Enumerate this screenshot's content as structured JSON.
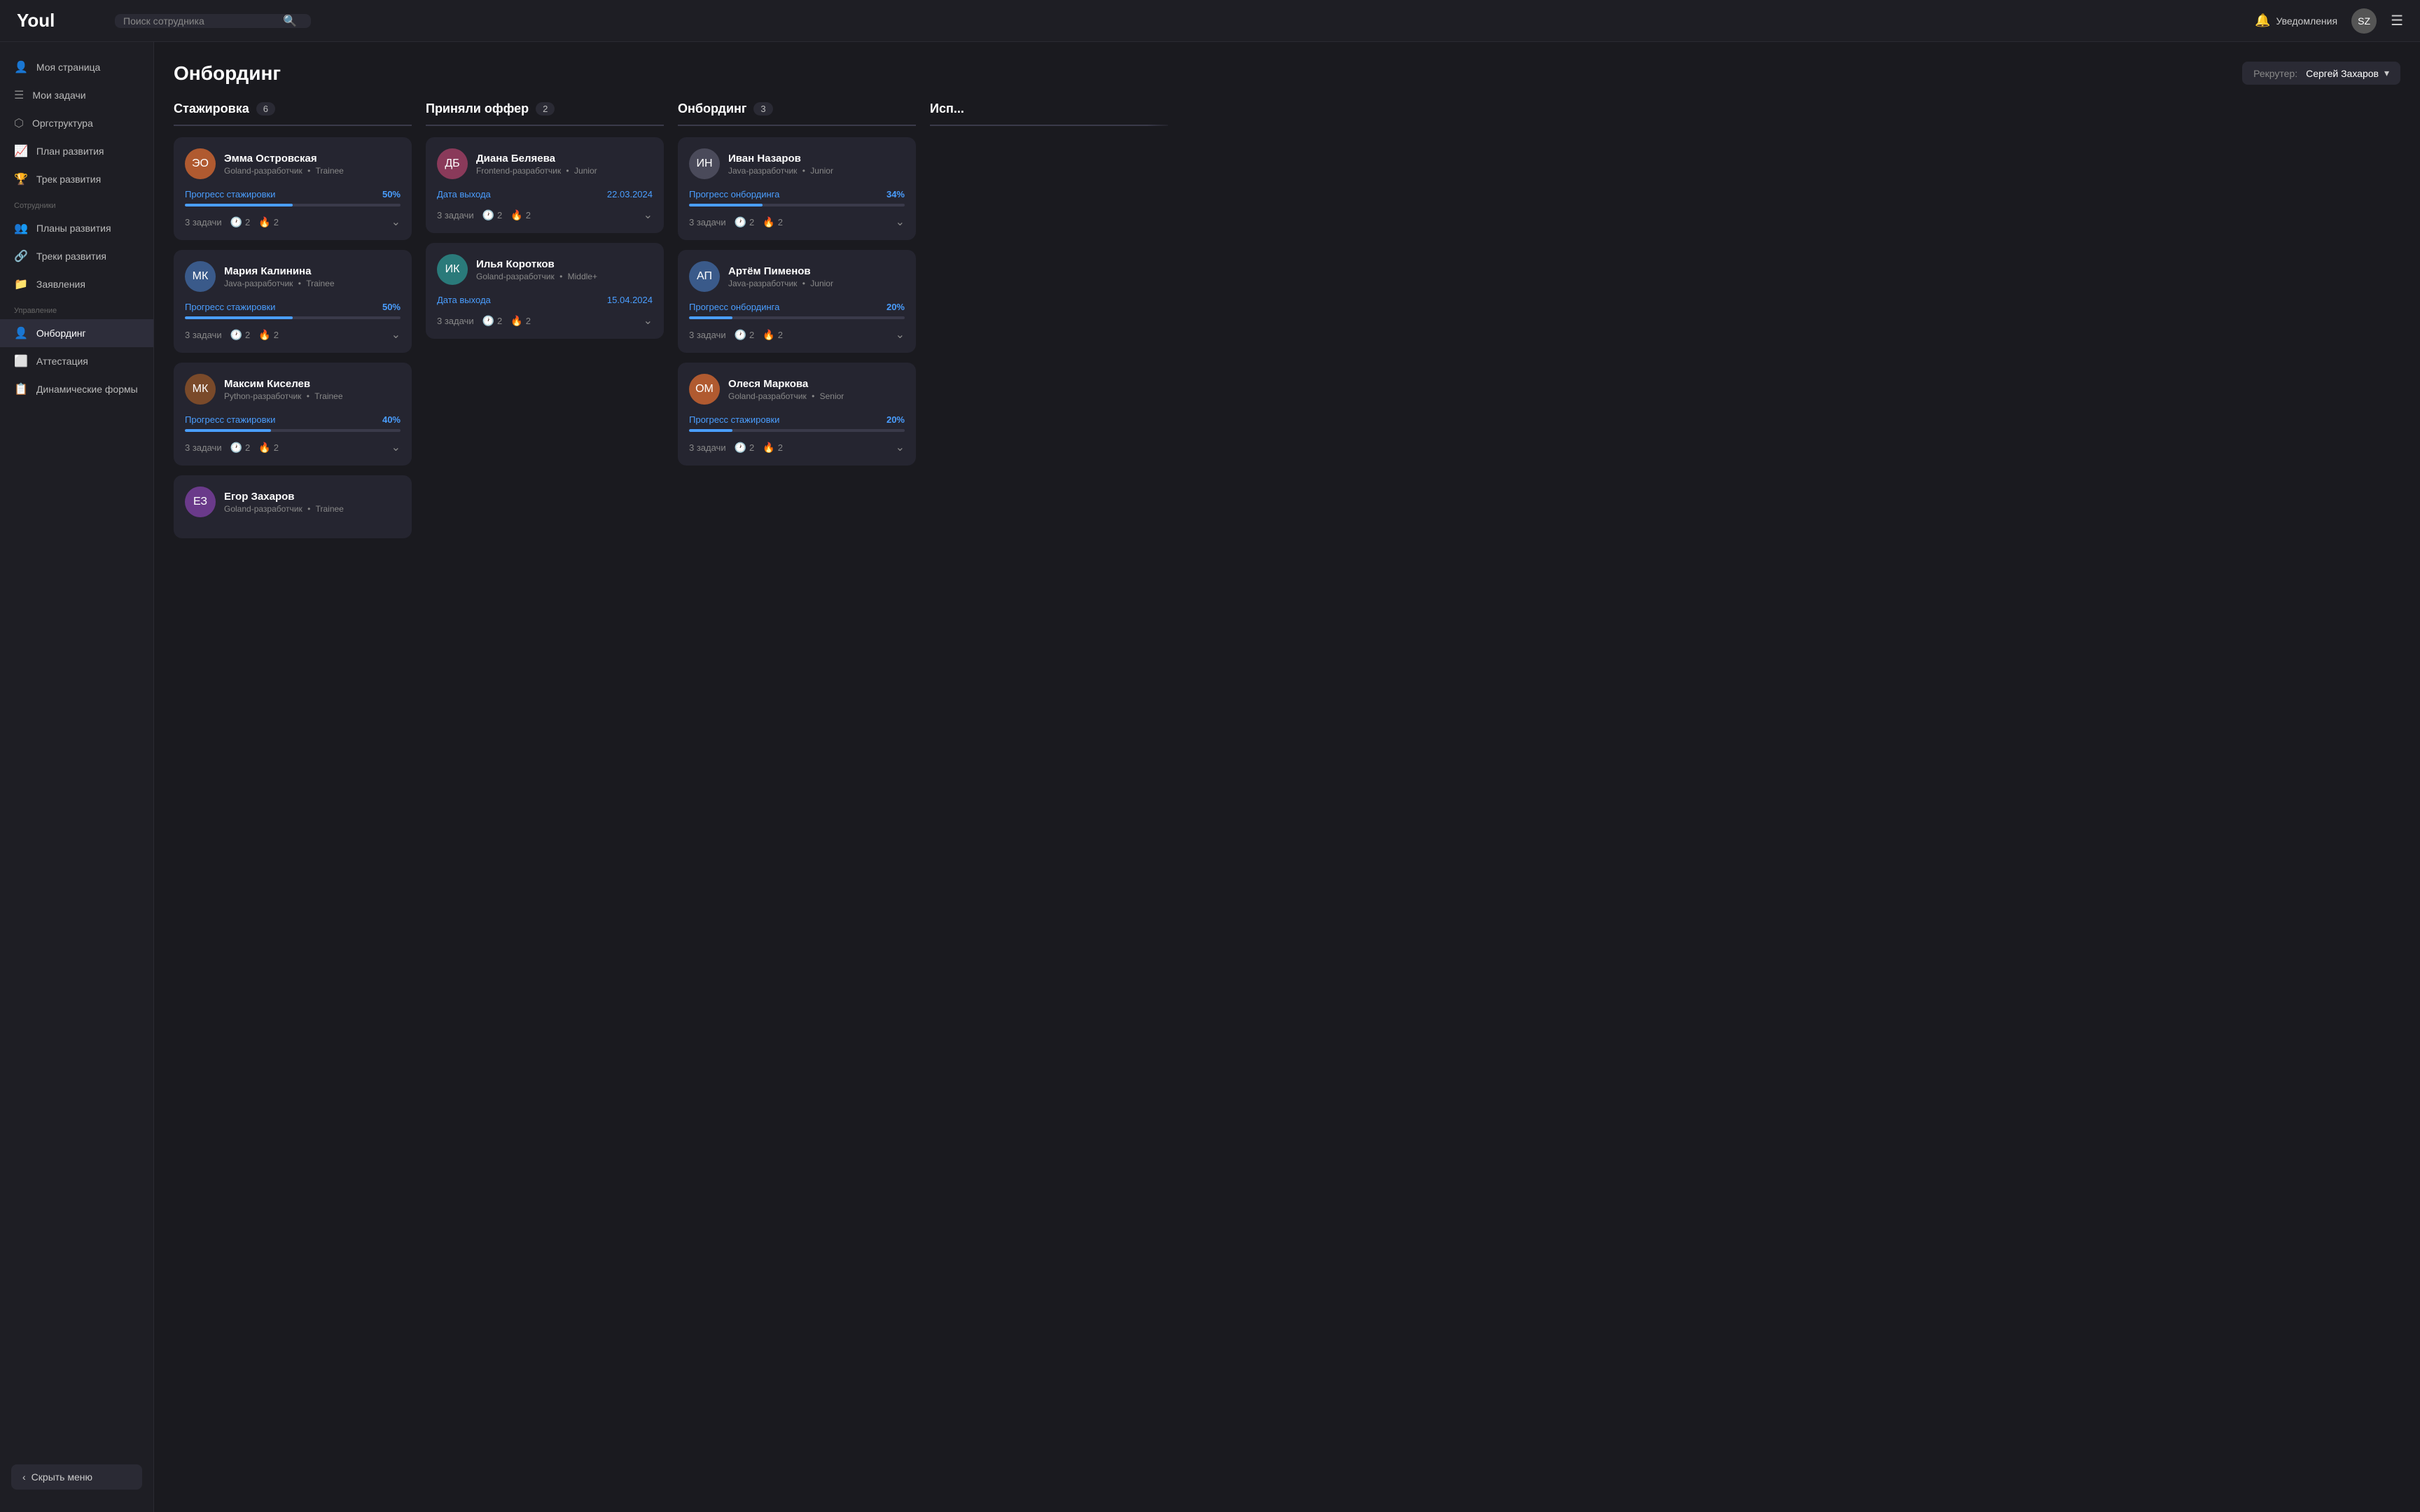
{
  "app": {
    "logo": "Youl"
  },
  "header": {
    "search_placeholder": "Поиск сотрудника",
    "notifications_label": "Уведомления",
    "recruiter_prefix": "Рекрутер:",
    "recruiter_name": "Сергей Захаров"
  },
  "sidebar": {
    "section_employees": "Сотрудники",
    "section_management": "Управление",
    "items_top": [
      {
        "id": "my-page",
        "label": "Моя страница",
        "icon": "👤"
      },
      {
        "id": "my-tasks",
        "label": "Мои задачи",
        "icon": "☰"
      },
      {
        "id": "org-structure",
        "label": "Оргструктура",
        "icon": "⬡"
      },
      {
        "id": "dev-plan",
        "label": "План развития",
        "icon": "📈"
      },
      {
        "id": "dev-track",
        "label": "Трек развития",
        "icon": "🏆"
      }
    ],
    "items_employees": [
      {
        "id": "dev-plans",
        "label": "Планы развития",
        "icon": "👥"
      },
      {
        "id": "dev-tracks",
        "label": "Треки развития",
        "icon": "🔗"
      },
      {
        "id": "applications",
        "label": "Заявления",
        "icon": "📁"
      }
    ],
    "items_management": [
      {
        "id": "onboarding",
        "label": "Онбординг",
        "icon": "👤",
        "active": true
      },
      {
        "id": "attestation",
        "label": "Аттестация",
        "icon": "🔲"
      },
      {
        "id": "dynamic-forms",
        "label": "Динамические формы",
        "icon": "📋"
      }
    ],
    "hide_menu": "Скрыть меню"
  },
  "page": {
    "title": "Онбординг"
  },
  "columns": [
    {
      "id": "internship",
      "title": "Стажировка",
      "count": 6,
      "cards": [
        {
          "id": "emma",
          "name": "Эмма Островская",
          "role": "Goland-разработчик",
          "level": "Trainee",
          "progress_label": "Прогресс стажировки",
          "progress_value": "50%",
          "progress_pct": 50,
          "tasks": "3 задачи",
          "clock_count": 2,
          "fire_count": 2,
          "avatar_color": "av-orange"
        },
        {
          "id": "maria",
          "name": "Мария Калинина",
          "role": "Java-разработчик",
          "level": "Trainee",
          "progress_label": "Прогресс стажировки",
          "progress_value": "50%",
          "progress_pct": 50,
          "tasks": "3 задачи",
          "clock_count": 2,
          "fire_count": 2,
          "avatar_color": "av-blue"
        },
        {
          "id": "maxim",
          "name": "Максим Киселев",
          "role": "Python-разработчик",
          "level": "Trainee",
          "progress_label": "Прогресс стажировки",
          "progress_value": "40%",
          "progress_pct": 40,
          "tasks": "3 задачи",
          "clock_count": 2,
          "fire_count": 2,
          "avatar_color": "av-brown"
        },
        {
          "id": "egor",
          "name": "Егор Захаров",
          "role": "Goland-разработчик",
          "level": "Trainee",
          "progress_label": "",
          "progress_value": "",
          "progress_pct": 0,
          "tasks": "",
          "clock_count": 0,
          "fire_count": 0,
          "avatar_color": "av-purple",
          "partial": true
        }
      ]
    },
    {
      "id": "offer",
      "title": "Приняли оффер",
      "count": 2,
      "cards": [
        {
          "id": "diana",
          "name": "Диана Беляева",
          "role": "Frontend-разработчик",
          "level": "Junior",
          "progress_label": "Дата выхода",
          "progress_value": "22.03.2024",
          "progress_pct": null,
          "is_date": true,
          "tasks": "3 задачи",
          "clock_count": 2,
          "fire_count": 2,
          "avatar_color": "av-pink"
        },
        {
          "id": "ilya",
          "name": "Илья Коротков",
          "role": "Goland-разработчик",
          "level": "Middle+",
          "progress_label": "Дата выхода",
          "progress_value": "15.04.2024",
          "progress_pct": null,
          "is_date": true,
          "tasks": "3 задачи",
          "clock_count": 2,
          "fire_count": 2,
          "avatar_color": "av-teal"
        }
      ]
    },
    {
      "id": "onboarding",
      "title": "Онбординг",
      "count": 3,
      "cards": [
        {
          "id": "ivan",
          "name": "Иван Назаров",
          "role": "Java-разработчик",
          "level": "Junior",
          "progress_label": "Прогресс онбординга",
          "progress_value": "34%",
          "progress_pct": 34,
          "tasks": "3 задачи",
          "clock_count": 2,
          "fire_count": 2,
          "avatar_color": "av-gray"
        },
        {
          "id": "artem",
          "name": "Артём Пименов",
          "role": "Java-разработчик",
          "level": "Junior",
          "progress_label": "Прогресс онбординга",
          "progress_value": "20%",
          "progress_pct": 20,
          "tasks": "3 задачи",
          "clock_count": 2,
          "fire_count": 2,
          "avatar_color": "av-blue"
        },
        {
          "id": "olesya",
          "name": "Олеся Маркова",
          "role": "Goland-разработчик",
          "level": "Senior",
          "progress_label": "Прогресс стажировки",
          "progress_value": "20%",
          "progress_pct": 20,
          "tasks": "3 задачи",
          "clock_count": 2,
          "fire_count": 2,
          "avatar_color": "av-orange"
        }
      ]
    },
    {
      "id": "completed",
      "title": "Исп...",
      "count": 0,
      "cards": [],
      "truncated": true
    }
  ]
}
